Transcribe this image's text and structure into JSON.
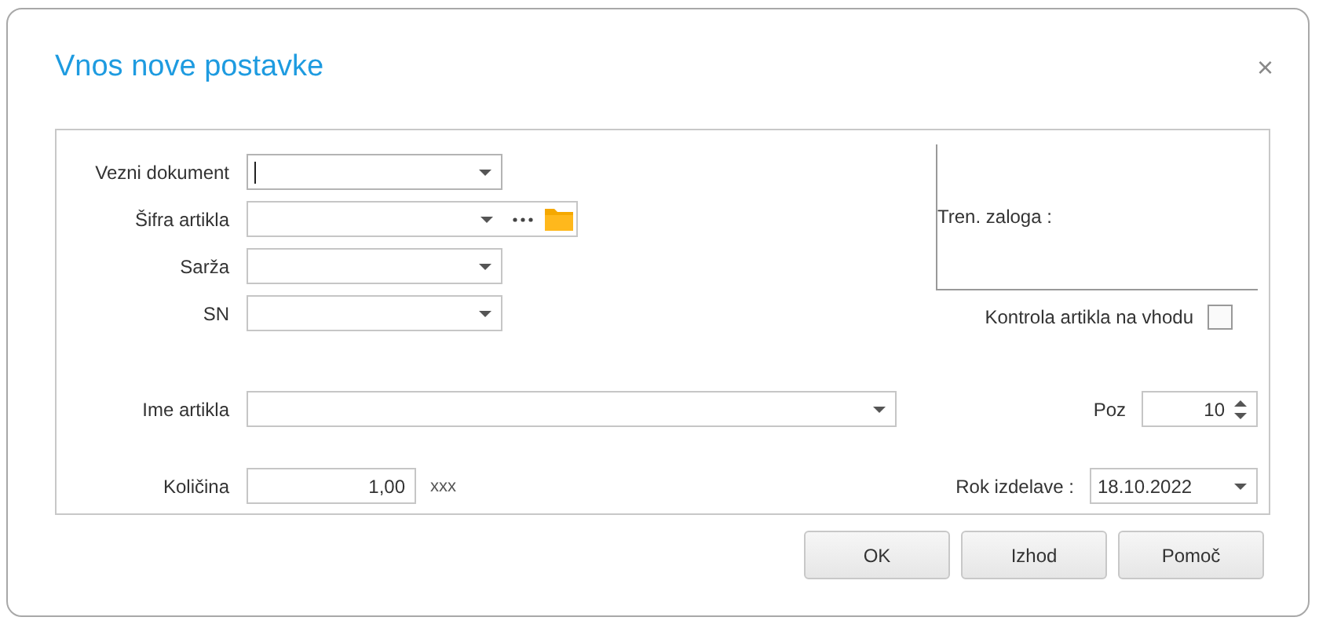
{
  "dialog": {
    "title": "Vnos nove postavke",
    "close": "×"
  },
  "fields": [
    {
      "label": "Vezni dokument",
      "kind": "combo",
      "focused": true
    },
    {
      "label": "Šifra artikla",
      "kind": "combo-browse",
      "focused": false
    },
    {
      "label": "Sarža",
      "kind": "combo",
      "focused": false
    },
    {
      "label": "SN",
      "kind": "combo",
      "focused": false
    }
  ],
  "stock": {
    "label": "Tren. zaloga :"
  },
  "input_check": {
    "label": "Kontrola artikla na vhodu",
    "checked": false
  },
  "article_name": {
    "label": "Ime artikla"
  },
  "position": {
    "label": "Poz",
    "value": "10"
  },
  "quantity": {
    "label": "Količina",
    "value": "1,00",
    "unit": "xxx"
  },
  "due_date": {
    "label": "Rok izdelave :",
    "value": "18.10.2022"
  },
  "buttons": [
    "OK",
    "Izhod",
    "Pomoč"
  ]
}
